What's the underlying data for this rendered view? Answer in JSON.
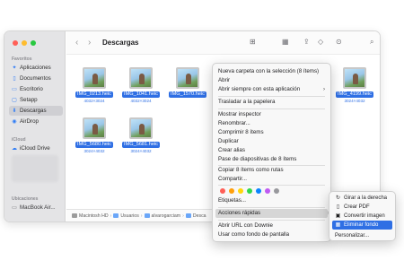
{
  "window": {
    "title": "Descargas",
    "nav": {
      "back": "‹",
      "forward": "›"
    }
  },
  "sidebar": {
    "favorites_heading": "Favoritos",
    "items": [
      {
        "label": "Aplicaciones",
        "icon": "apps-icon"
      },
      {
        "label": "Documentos",
        "icon": "document-icon"
      },
      {
        "label": "Escritorio",
        "icon": "desktop-icon"
      },
      {
        "label": "Setapp",
        "icon": "setapp-icon"
      },
      {
        "label": "Descargas",
        "icon": "downloads-icon"
      },
      {
        "label": "AirDrop",
        "icon": "airdrop-icon"
      }
    ],
    "icloud_heading": "iCloud",
    "icloud_items": [
      {
        "label": "iCloud Drive",
        "icon": "cloud-icon"
      }
    ],
    "locations_heading": "Ubicaciones",
    "locations_items": [
      {
        "label": "MacBook Air...",
        "icon": "laptop-icon"
      }
    ]
  },
  "files": [
    {
      "name": "IMG_0213.heic",
      "dims": "4032×3024"
    },
    {
      "name": "IMG_1041.heic",
      "dims": "4032×3024"
    },
    {
      "name": "IMG_1570.heic",
      "dims": ""
    },
    {
      "name": "IMG_4199.heic",
      "dims": "3024×4032"
    },
    {
      "name": "IMG_5680.heic",
      "dims": "3024×4032"
    },
    {
      "name": "IMG_5681.heic",
      "dims": "3024×4032"
    }
  ],
  "pathbar": [
    "Macintosh HD",
    "Usuarios",
    "alvarogarciam",
    "Desca"
  ],
  "context_menu": {
    "items": [
      "Nueva carpeta con la selección (8 ítems)",
      "Abrir",
      "Abrir siempre con esta aplicación",
      "Trasladar a la papelera",
      "Mostrar inspector",
      "Renombrar...",
      "Comprimir 8 ítems",
      "Duplicar",
      "Crear alias",
      "Pase de diapositivas de 8 ítems",
      "Copiar 8 ítems como rutas",
      "Compartir...",
      "Etiquetas...",
      "Acciones rápidas",
      "Abrir URL con Downie",
      "Usar como fondo de pantalla"
    ],
    "tag_colors": [
      "#ff5f57",
      "#ff9f0a",
      "#ffd60a",
      "#32d74b",
      "#0a84ff",
      "#bf5af2",
      "#98989d"
    ]
  },
  "submenu": {
    "items": [
      {
        "label": "Girar a la derecha",
        "icon": "rotate-icon"
      },
      {
        "label": "Crear PDF",
        "icon": "pdf-icon"
      },
      {
        "label": "Convertir imagen",
        "icon": "convert-icon"
      },
      {
        "label": "Eliminar fondo",
        "icon": "remove-background-icon"
      },
      {
        "label": "Personalizar...",
        "icon": ""
      }
    ]
  },
  "colors": {
    "accent": "#2f6fe4",
    "selection_text": "#ffffff"
  }
}
